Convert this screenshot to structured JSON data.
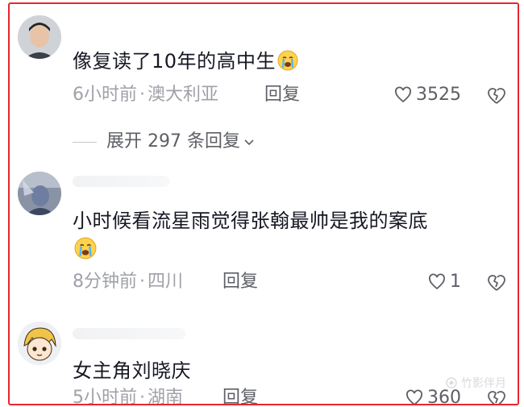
{
  "comments": [
    {
      "text": "像复读了10年的高中生",
      "emoji": "loudly-crying-face",
      "time": "6小时前",
      "location": "澳大利亚",
      "reply_label": "回复",
      "like_count": "3525"
    },
    {
      "text": "小时候看流星雨觉得张翰最帅是我的案底",
      "emoji": "loudly-crying-face",
      "time": "8分钟前",
      "location": "四川",
      "reply_label": "回复",
      "like_count": "1"
    },
    {
      "text": "女主角刘晓庆",
      "time": "5小时前",
      "location": "湖南",
      "reply_label": "回复",
      "like_count": "360"
    }
  ],
  "expand_replies": "展开 297 条回复",
  "separator": "·",
  "watermark": "竹影伴月",
  "colors": {
    "border": "#e8262e",
    "meta": "#9fa1a8",
    "text": "#161823"
  }
}
